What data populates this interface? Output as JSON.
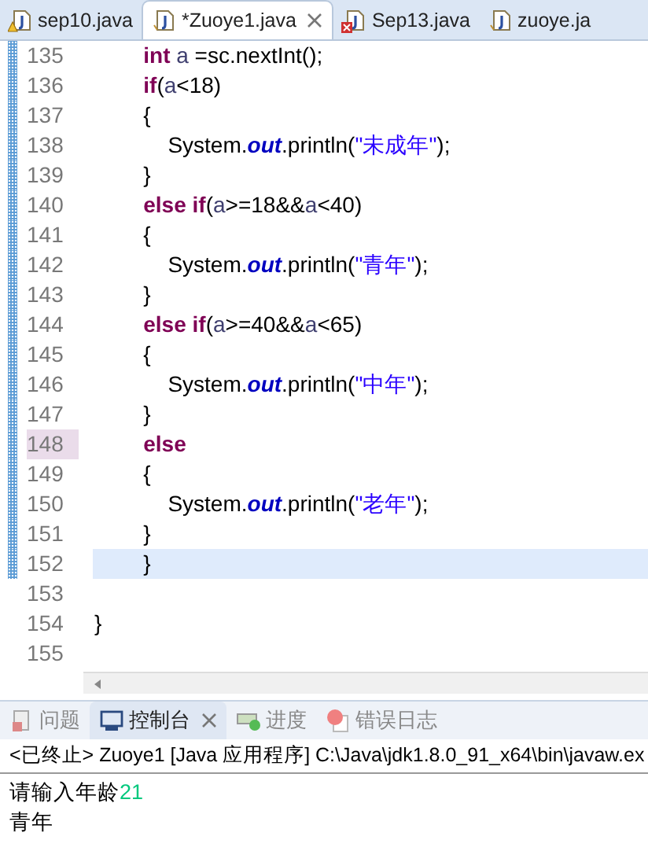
{
  "editor_tabs": [
    {
      "label": "sep10.java",
      "kind": "warning",
      "selected": false,
      "closable": false
    },
    {
      "label": "*Zuoye1.java",
      "kind": "plain",
      "selected": true,
      "closable": true
    },
    {
      "label": "Sep13.java",
      "kind": "error",
      "selected": false,
      "closable": false
    },
    {
      "label": "zuoye.ja",
      "kind": "plain",
      "selected": false,
      "closable": false
    }
  ],
  "code_lines": [
    {
      "number": "135",
      "changed": true,
      "current": false,
      "marked": false,
      "tokens": [
        {
          "kind": "keyword",
          "text": "\t\tint "
        },
        {
          "kind": "var",
          "text": "a"
        },
        {
          "kind": "plain",
          "text": " =sc.nextInt();"
        }
      ]
    },
    {
      "number": "136",
      "changed": true,
      "current": false,
      "marked": false,
      "tokens": [
        {
          "kind": "keyword",
          "text": "\t\tif"
        },
        {
          "kind": "plain",
          "text": "("
        },
        {
          "kind": "var",
          "text": "a"
        },
        {
          "kind": "plain",
          "text": "<18)"
        }
      ]
    },
    {
      "number": "137",
      "changed": true,
      "current": false,
      "marked": false,
      "tokens": [
        {
          "kind": "plain",
          "text": "\t\t{"
        }
      ]
    },
    {
      "number": "138",
      "changed": true,
      "current": false,
      "marked": false,
      "tokens": [
        {
          "kind": "plain",
          "text": "\t\t\tSystem."
        },
        {
          "kind": "field",
          "text": "out"
        },
        {
          "kind": "plain",
          "text": ".println("
        },
        {
          "kind": "string",
          "text": "\"未成年\""
        },
        {
          "kind": "plain",
          "text": ");"
        }
      ]
    },
    {
      "number": "139",
      "changed": true,
      "current": false,
      "marked": false,
      "tokens": [
        {
          "kind": "plain",
          "text": "\t\t}"
        }
      ]
    },
    {
      "number": "140",
      "changed": true,
      "current": false,
      "marked": false,
      "tokens": [
        {
          "kind": "keyword",
          "text": "\t\telse if"
        },
        {
          "kind": "plain",
          "text": "("
        },
        {
          "kind": "var",
          "text": "a"
        },
        {
          "kind": "plain",
          "text": ">=18&&"
        },
        {
          "kind": "var",
          "text": "a"
        },
        {
          "kind": "plain",
          "text": "<40)"
        }
      ]
    },
    {
      "number": "141",
      "changed": true,
      "current": false,
      "marked": false,
      "tokens": [
        {
          "kind": "plain",
          "text": "\t\t{"
        }
      ]
    },
    {
      "number": "142",
      "changed": true,
      "current": false,
      "marked": false,
      "tokens": [
        {
          "kind": "plain",
          "text": "\t\t\tSystem."
        },
        {
          "kind": "field",
          "text": "out"
        },
        {
          "kind": "plain",
          "text": ".println("
        },
        {
          "kind": "string",
          "text": "\"青年\""
        },
        {
          "kind": "plain",
          "text": ");"
        }
      ]
    },
    {
      "number": "143",
      "changed": true,
      "current": false,
      "marked": false,
      "tokens": [
        {
          "kind": "plain",
          "text": "\t\t}"
        }
      ]
    },
    {
      "number": "144",
      "changed": true,
      "current": false,
      "marked": false,
      "tokens": [
        {
          "kind": "keyword",
          "text": "\t\telse if"
        },
        {
          "kind": "plain",
          "text": "("
        },
        {
          "kind": "var",
          "text": "a"
        },
        {
          "kind": "plain",
          "text": ">=40&&"
        },
        {
          "kind": "var",
          "text": "a"
        },
        {
          "kind": "plain",
          "text": "<65)"
        }
      ]
    },
    {
      "number": "145",
      "changed": true,
      "current": false,
      "marked": false,
      "tokens": [
        {
          "kind": "plain",
          "text": "\t\t{"
        }
      ]
    },
    {
      "number": "146",
      "changed": true,
      "current": false,
      "marked": false,
      "tokens": [
        {
          "kind": "plain",
          "text": "\t\t\tSystem."
        },
        {
          "kind": "field",
          "text": "out"
        },
        {
          "kind": "plain",
          "text": ".println("
        },
        {
          "kind": "string",
          "text": "\"中年\""
        },
        {
          "kind": "plain",
          "text": ");"
        }
      ]
    },
    {
      "number": "147",
      "changed": true,
      "current": false,
      "marked": false,
      "tokens": [
        {
          "kind": "plain",
          "text": "\t\t}"
        }
      ]
    },
    {
      "number": "148",
      "changed": true,
      "current": false,
      "marked": true,
      "tokens": [
        {
          "kind": "keyword",
          "text": "\t\telse"
        }
      ]
    },
    {
      "number": "149",
      "changed": true,
      "current": false,
      "marked": false,
      "tokens": [
        {
          "kind": "plain",
          "text": "\t\t{"
        }
      ]
    },
    {
      "number": "150",
      "changed": true,
      "current": false,
      "marked": false,
      "tokens": [
        {
          "kind": "plain",
          "text": "\t\t\tSystem."
        },
        {
          "kind": "field",
          "text": "out"
        },
        {
          "kind": "plain",
          "text": ".println("
        },
        {
          "kind": "string",
          "text": "\"老年\""
        },
        {
          "kind": "plain",
          "text": ");"
        }
      ]
    },
    {
      "number": "151",
      "changed": true,
      "current": false,
      "marked": false,
      "tokens": [
        {
          "kind": "plain",
          "text": "\t\t}"
        }
      ]
    },
    {
      "number": "152",
      "changed": true,
      "current": true,
      "marked": false,
      "tokens": [
        {
          "kind": "plain",
          "text": "\t\t}"
        }
      ]
    },
    {
      "number": "153",
      "changed": false,
      "marked": false
    },
    {
      "number": "154",
      "changed": false,
      "current": false,
      "marked": false,
      "tokens": [
        {
          "kind": "plain",
          "text": "}"
        }
      ]
    },
    {
      "number": "155",
      "changed": false,
      "marked": false
    }
  ],
  "panel_tabs": [
    {
      "label": "问题",
      "kind": "problems",
      "selected": false,
      "closable": false
    },
    {
      "label": "控制台",
      "kind": "console",
      "selected": true,
      "closable": true
    },
    {
      "label": "进度",
      "kind": "progress",
      "selected": false,
      "closable": false
    },
    {
      "label": "错误日志",
      "kind": "log",
      "selected": false,
      "closable": false
    }
  ],
  "console": {
    "header": "<已终止> Zuoye1 [Java 应用程序] C:\\Java\\jdk1.8.0_91_x64\\bin\\javaw.ex",
    "lines": [
      [
        {
          "kind": "stdout",
          "text": "请输入年龄"
        },
        {
          "kind": "stdin",
          "text": "21"
        }
      ],
      [
        {
          "kind": "stdout",
          "text": "青年"
        }
      ]
    ]
  }
}
